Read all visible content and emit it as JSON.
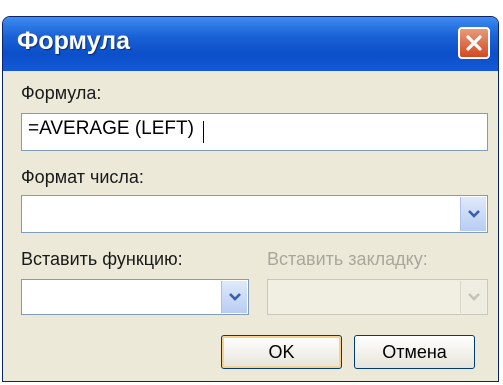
{
  "dialog": {
    "title": "Формула",
    "formula": {
      "label": "Формула:",
      "value": "=AVERAGE (LEFT)"
    },
    "number_format": {
      "label": "Формат числа:",
      "value": ""
    },
    "paste_function": {
      "label": "Вставить функцию:",
      "value": ""
    },
    "paste_bookmark": {
      "label": "Вставить закладку:",
      "value": ""
    },
    "buttons": {
      "ok": "OK",
      "cancel": "Отмена"
    }
  },
  "icons": {
    "close": "close-icon",
    "dropdown": "chevron-down-icon"
  },
  "colors": {
    "titlebar": "#0b4fc9",
    "close_button": "#d24a22",
    "dialog_background": "#ece9d8"
  }
}
